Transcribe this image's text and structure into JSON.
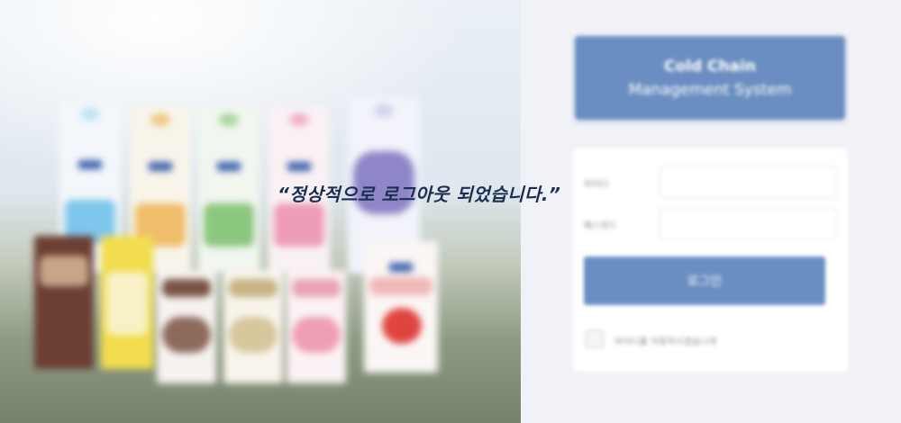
{
  "logout_message": "“정상적으로 로그아웃 되었습니다.”",
  "brand": {
    "title": "Cold Chain",
    "subtitle": "Management System"
  },
  "login_form": {
    "id_label": "아이디",
    "password_label": "패스워드",
    "id_value": "",
    "password_value": "",
    "login_button": "로그인",
    "remember_label": "아이디를 저장하시겠습니까"
  },
  "colors": {
    "brand_blue": "#6a8ec1",
    "message_text": "#1c2d52",
    "panel_bg": "#f1f2f7"
  },
  "icons": [
    "milk-carton-icon",
    "strawberry-icon",
    "checkbox-icon"
  ]
}
